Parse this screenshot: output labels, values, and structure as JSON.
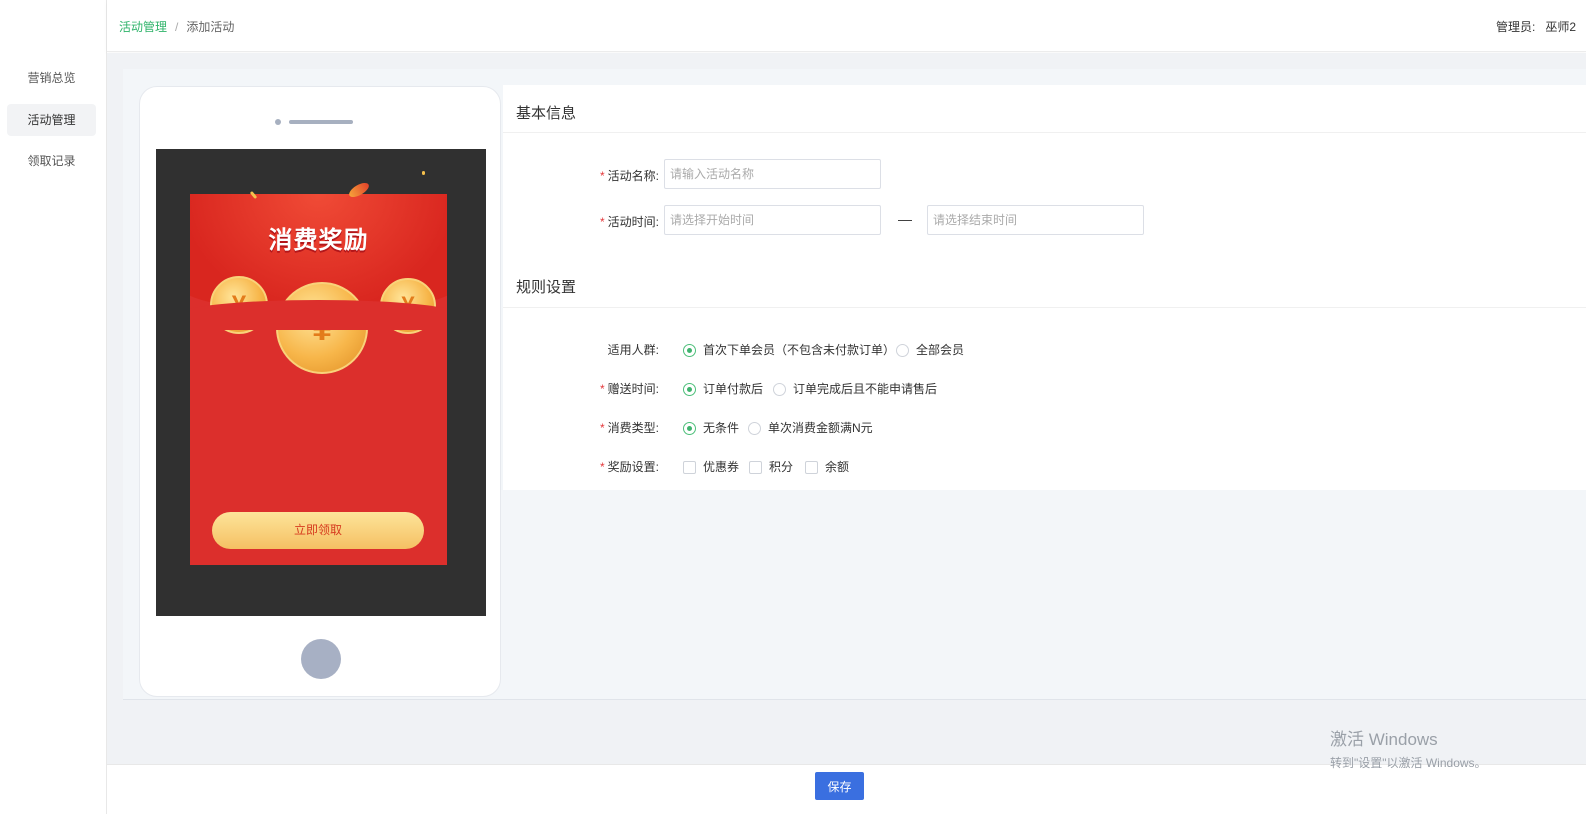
{
  "sidebar": {
    "items": [
      {
        "label": "营销总览"
      },
      {
        "label": "活动管理"
      },
      {
        "label": "领取记录"
      }
    ]
  },
  "header": {
    "breadcrumb": {
      "parent": "活动管理",
      "separator": "/",
      "current": "添加活动"
    },
    "admin_label": "管理员:",
    "admin_name": "巫师2"
  },
  "preview": {
    "title": "消费奖励",
    "button_label": "立即领取",
    "coin_symbol": "¥"
  },
  "basic_info": {
    "section_title": "基本信息",
    "name_label": "活动名称:",
    "name_placeholder": "请输入活动名称",
    "time_label": "活动时间:",
    "start_placeholder": "请选择开始时间",
    "time_separator": "—",
    "end_placeholder": "请选择结束时间"
  },
  "rules": {
    "section_title": "规则设置",
    "audience": {
      "label": "适用人群:",
      "options": [
        "首次下单会员（不包含未付款订单）",
        "全部会员"
      ],
      "selected": 0
    },
    "gift_time": {
      "label": "赠送时间:",
      "options": [
        "订单付款后",
        "订单完成后且不能申请售后"
      ],
      "selected": 0
    },
    "consume_type": {
      "label": "消费类型:",
      "options": [
        "无条件",
        "单次消费金额满N元"
      ],
      "selected": 0
    },
    "reward": {
      "label": "奖励设置:",
      "options": [
        "优惠券",
        "积分",
        "余额"
      ]
    }
  },
  "footer": {
    "save_label": "保存"
  },
  "watermark": {
    "title": "激活 Windows",
    "subtitle": "转到\"设置\"以激活 Windows。"
  },
  "colors": {
    "accent": "#3a6fe0",
    "success": "#2fb36a",
    "required": "#e4393c",
    "envelope": "#dc2f2c"
  }
}
